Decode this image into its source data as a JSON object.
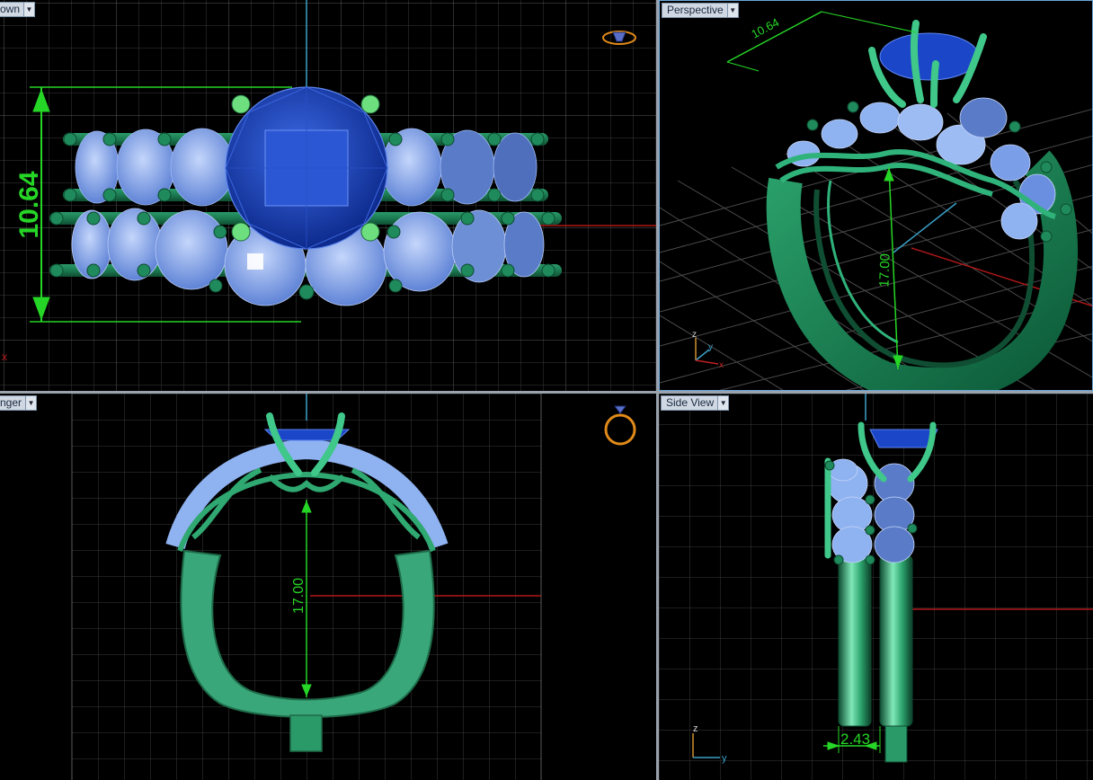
{
  "viewports": {
    "top_left": {
      "tab_label": "own",
      "dimension": "10.64",
      "axis_label": "x"
    },
    "top_right": {
      "tab_label": "Perspective",
      "dimension_top": "10.64",
      "dimension_ring": "17.00",
      "axis": {
        "z": "z",
        "y": "y",
        "x": "x"
      }
    },
    "bottom_left": {
      "tab_label": "nger",
      "dimension": "17.00"
    },
    "bottom_right": {
      "tab_label": "Side View",
      "dimension": "2.43",
      "axis": {
        "z": "z",
        "y": "y"
      }
    }
  },
  "colors": {
    "metal": "#1f8a5b",
    "metal_light": "#3fc88a",
    "center_stone": "#1c46c8",
    "side_stones": "#8fb2f0",
    "dimension": "#26d626",
    "grid": "#3a3a3a",
    "axis_red": "#b01818"
  },
  "icons": [
    "dropdown-arrow-icon",
    "ring-view-icon"
  ]
}
